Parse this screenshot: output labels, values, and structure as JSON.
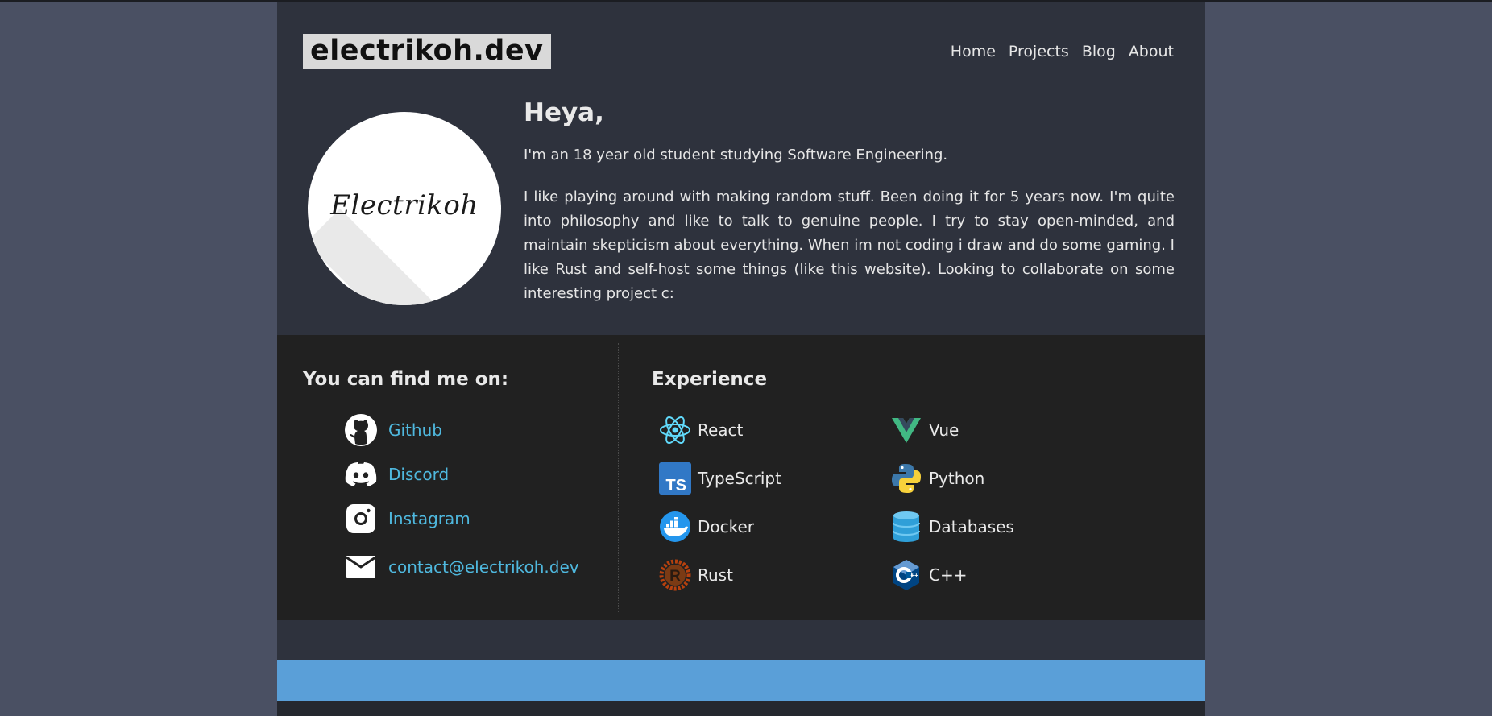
{
  "header": {
    "logo": "electrikoh.dev",
    "nav": [
      "Home",
      "Projects",
      "Blog",
      "About"
    ]
  },
  "hero": {
    "avatar_text": "Electrikoh",
    "title": "Heya,",
    "intro": "I'm an 18 year old student studying Software Engineering.",
    "bio": "I like playing around with making random stuff. Been doing it for 5 years now. I'm quite into philosophy and like to talk to genuine people. I try to stay open-minded, and maintain skepticism about everything. When im not coding i draw and do some gaming. I like Rust and self-host some things (like this website). Looking to collaborate on some interesting project c:"
  },
  "socials": {
    "title": "You can find me on:",
    "items": [
      {
        "label": "Github",
        "icon": "github-icon"
      },
      {
        "label": "Discord",
        "icon": "discord-icon"
      },
      {
        "label": "Instagram",
        "icon": "instagram-icon"
      },
      {
        "label": "contact@electrikoh.dev",
        "icon": "mail-icon"
      }
    ]
  },
  "experience": {
    "title": "Experience",
    "items": [
      {
        "label": "React",
        "icon": "react-icon"
      },
      {
        "label": "Vue",
        "icon": "vue-icon"
      },
      {
        "label": "TypeScript",
        "icon": "typescript-icon"
      },
      {
        "label": "Python",
        "icon": "python-icon"
      },
      {
        "label": "Docker",
        "icon": "docker-icon"
      },
      {
        "label": "Databases",
        "icon": "database-icon"
      },
      {
        "label": "Rust",
        "icon": "rust-icon"
      },
      {
        "label": "C++",
        "icon": "cpp-icon"
      }
    ]
  },
  "colors": {
    "background": "#4a5063",
    "page": "#2e323d",
    "section": "#212121",
    "link": "#4fb8de",
    "footer_bar": "#5a9fd8"
  }
}
